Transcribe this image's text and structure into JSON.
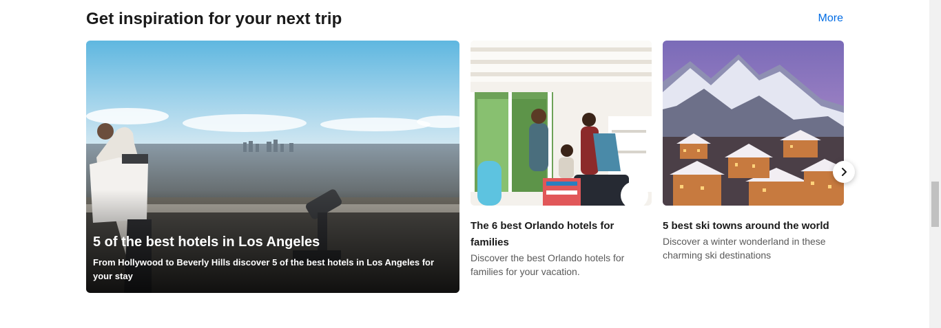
{
  "section": {
    "title": "Get inspiration for your next trip",
    "more_label": "More"
  },
  "featured": {
    "title": "5 of the best hotels in Los Angeles",
    "description": "From Hollywood to Beverly Hills discover 5 of the best hotels in Los Angeles for your stay"
  },
  "cards": [
    {
      "title": "The 6 best Orlando hotels for families",
      "description": "Discover the best Orlando hotels for families for your vacation."
    },
    {
      "title": "5 best ski towns around the world",
      "description": "Discover a winter wonderland in these charming ski destinations"
    }
  ],
  "colors": {
    "link": "#006ce4",
    "text": "#1a1a1a",
    "muted": "#595959"
  },
  "icons": {
    "next": "chevron-right-icon"
  }
}
